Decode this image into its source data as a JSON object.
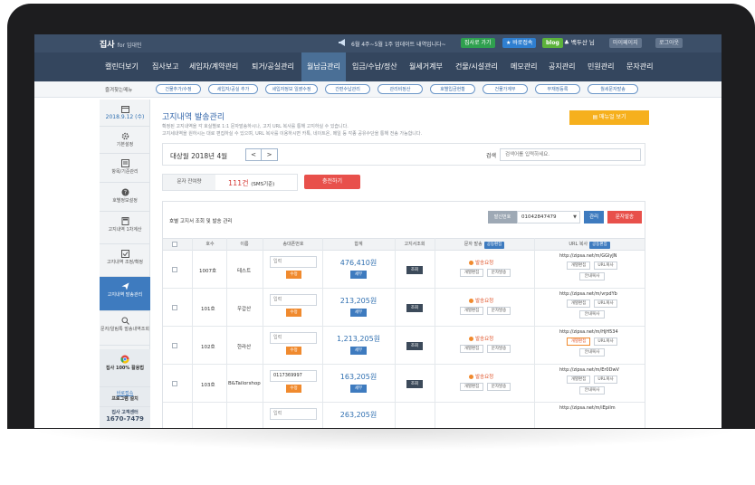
{
  "topbar": {
    "logo_main": "집사",
    "logo_for": "for 임대인",
    "notice": "6월 4주~5월 1주 업데이트 내역입니다~",
    "btn_guide": "집사로 가기",
    "btn_bookmark": "★ 바로접속",
    "btn_blog": "blog",
    "user": "♣ 백두산 님",
    "btn_mypage": "마이페이지",
    "btn_logout": "로그아웃"
  },
  "mainnav": {
    "items": [
      "캘린더보기",
      "집사보고",
      "세입자/계약관리",
      "퇴거/공실관리",
      "월납금관리",
      "입금/수납/정산",
      "월세거계부",
      "건물/시설관리",
      "메모관리",
      "공지관리",
      "민원관리",
      "문자관리"
    ],
    "active_index": 4
  },
  "subnav": {
    "label": "즐겨찾는메뉴",
    "pills": [
      "건물추가/수정",
      "세입자/공실 추가",
      "세입자정보 일괄수정",
      "간편수납관리",
      "관리비정산",
      "호별입금현황",
      "건물가계부",
      "부재정등록",
      "월세문자발송"
    ]
  },
  "sidebar": {
    "date": "2018.9.12 (수)",
    "items": [
      {
        "icon": "gear-icon",
        "label": "기본설정"
      },
      {
        "icon": "list-icon",
        "label": "항목/기준관리"
      },
      {
        "icon": "help-icon",
        "label": "호별정보설정"
      },
      {
        "icon": "calculator-icon",
        "label": "고지내역 1차계산"
      },
      {
        "icon": "check-icon",
        "label": "고지내역 조정/확정"
      },
      {
        "icon": "send-icon",
        "label": "고지내역 발송관리"
      },
      {
        "icon": "search-icon",
        "label": "문자/알림톡 발송내역조회"
      }
    ],
    "chrome_label": "집사 100% 활용법",
    "install_label1": "바로접속",
    "install_label2": "프로그램 설치",
    "support_label": "집사 고객센터",
    "support_phone": "1670-7479"
  },
  "page": {
    "title": "고지내역",
    "title_sub": "발송관리",
    "desc_line1": "확정된 고지내역을 각 호실별로 1:1 문자발송하시나, 고지 URL 복사를 통해 고지하실 수 있습니다.",
    "desc_line2": "고지세내역을 원하시는 대로 편집하실 수 있으며, URL 복사를 이용하시면 카톡, 네이트온, 메일 등 각종 공유수단을 통해 전송 가능합니다.",
    "manual_btn": "매뉴얼 보기"
  },
  "period": {
    "label": "대상월  2018년 4월",
    "prev": "<",
    "next": ">",
    "search_label": "검색",
    "search_placeholder": "검색어를 입력하세요."
  },
  "sms": {
    "label": "문자 잔여량",
    "value": "111건",
    "unit": "(SMS기준)",
    "recharge_btn": "충전하기"
  },
  "list": {
    "title": "호별 고지서 조회 및 발송 관리",
    "sender_label": "발신번호",
    "sender_number": "01042847479",
    "manage_btn": "관리",
    "send_btn": "문자발송",
    "columns": [
      "호수",
      "이름",
      "송대폰번호",
      "합계",
      "고지서조회",
      "문자 발송",
      "URL 복사"
    ],
    "batch_edit": "공동편집",
    "rows": [
      {
        "unit": "1007호",
        "name": "테스트",
        "phone_placeholder": "입력",
        "phone": "",
        "amount": "476,410원",
        "status": "발송요청",
        "url": "http://zipsa.net/m/GGlyJN"
      },
      {
        "unit": "101호",
        "name": "우갑산",
        "phone_placeholder": "입력",
        "phone": "",
        "amount": "213,205원",
        "status": "발송요청",
        "url": "http://zipsa.net/m/vrpdYb"
      },
      {
        "unit": "102호",
        "name": "한라산",
        "phone_placeholder": "입력",
        "phone": "",
        "amount": "1,213,205원",
        "status": "발송요청",
        "url": "http://zipsa.net/m/HjH534"
      },
      {
        "unit": "103호",
        "name": "B&Tailorshop",
        "phone_placeholder": "",
        "phone": "0117369997",
        "amount": "163,205원",
        "status": "발송요청",
        "url": "http://zipsa.net/m/Er0DwV"
      },
      {
        "unit": "",
        "name": "",
        "phone_placeholder": "입력",
        "phone": "",
        "amount": "263,205원",
        "status": "",
        "url": "http://zipsa.net/m/iEpilm"
      }
    ],
    "fix_btn": "수정",
    "detail_btn": "세부",
    "view_btn": "조회",
    "edit_each": "개별편집",
    "sms_send": "문자발송",
    "url_copy": "URL복사",
    "guide_copy": "안내복사"
  },
  "colors": {
    "nav_bg": "#34465e",
    "accent_blue": "#3e7bbf",
    "accent_red": "#e8504b",
    "accent_orange": "#f08a2e",
    "yellow": "#f6b01d"
  }
}
